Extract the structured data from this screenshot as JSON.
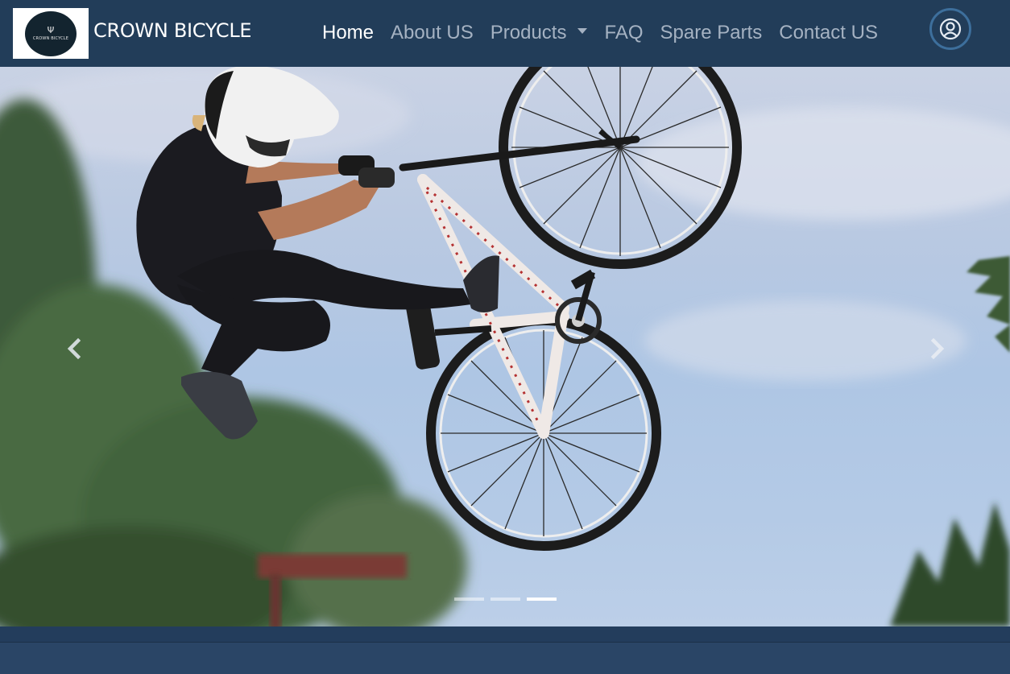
{
  "brand": {
    "logo_text": "CROWN BICYCLE",
    "name": "CROWN BICYCLE"
  },
  "nav": {
    "items": [
      {
        "label": "Home",
        "active": true
      },
      {
        "label": "About US"
      },
      {
        "label": "Products",
        "dropdown": true
      },
      {
        "label": "FAQ"
      },
      {
        "label": "Spare Parts"
      },
      {
        "label": "Contact US"
      }
    ]
  },
  "account": {
    "icon": "user-circle-icon"
  },
  "carousel": {
    "prev_icon": "chevron-left-icon",
    "next_icon": "chevron-right-icon",
    "slide_count": 3,
    "active_slide": 3
  },
  "colors": {
    "navbar_bg": "#223d59",
    "nav_active": "#ffffff",
    "nav_inactive": "#a5b2c2",
    "footer_bg": "#233d5c"
  }
}
